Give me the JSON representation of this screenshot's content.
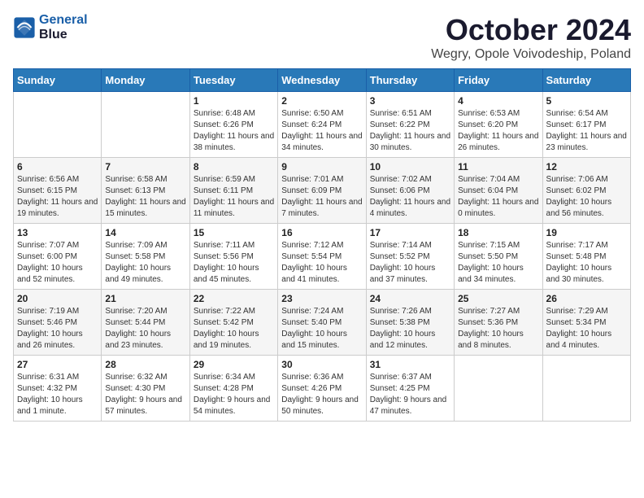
{
  "logo": {
    "line1": "General",
    "line2": "Blue"
  },
  "title": "October 2024",
  "location": "Wegry, Opole Voivodeship, Poland",
  "weekdays": [
    "Sunday",
    "Monday",
    "Tuesday",
    "Wednesday",
    "Thursday",
    "Friday",
    "Saturday"
  ],
  "weeks": [
    [
      {
        "day": "",
        "sunrise": "",
        "sunset": "",
        "daylight": ""
      },
      {
        "day": "",
        "sunrise": "",
        "sunset": "",
        "daylight": ""
      },
      {
        "day": "1",
        "sunrise": "Sunrise: 6:48 AM",
        "sunset": "Sunset: 6:26 PM",
        "daylight": "Daylight: 11 hours and 38 minutes."
      },
      {
        "day": "2",
        "sunrise": "Sunrise: 6:50 AM",
        "sunset": "Sunset: 6:24 PM",
        "daylight": "Daylight: 11 hours and 34 minutes."
      },
      {
        "day": "3",
        "sunrise": "Sunrise: 6:51 AM",
        "sunset": "Sunset: 6:22 PM",
        "daylight": "Daylight: 11 hours and 30 minutes."
      },
      {
        "day": "4",
        "sunrise": "Sunrise: 6:53 AM",
        "sunset": "Sunset: 6:20 PM",
        "daylight": "Daylight: 11 hours and 26 minutes."
      },
      {
        "day": "5",
        "sunrise": "Sunrise: 6:54 AM",
        "sunset": "Sunset: 6:17 PM",
        "daylight": "Daylight: 11 hours and 23 minutes."
      }
    ],
    [
      {
        "day": "6",
        "sunrise": "Sunrise: 6:56 AM",
        "sunset": "Sunset: 6:15 PM",
        "daylight": "Daylight: 11 hours and 19 minutes."
      },
      {
        "day": "7",
        "sunrise": "Sunrise: 6:58 AM",
        "sunset": "Sunset: 6:13 PM",
        "daylight": "Daylight: 11 hours and 15 minutes."
      },
      {
        "day": "8",
        "sunrise": "Sunrise: 6:59 AM",
        "sunset": "Sunset: 6:11 PM",
        "daylight": "Daylight: 11 hours and 11 minutes."
      },
      {
        "day": "9",
        "sunrise": "Sunrise: 7:01 AM",
        "sunset": "Sunset: 6:09 PM",
        "daylight": "Daylight: 11 hours and 7 minutes."
      },
      {
        "day": "10",
        "sunrise": "Sunrise: 7:02 AM",
        "sunset": "Sunset: 6:06 PM",
        "daylight": "Daylight: 11 hours and 4 minutes."
      },
      {
        "day": "11",
        "sunrise": "Sunrise: 7:04 AM",
        "sunset": "Sunset: 6:04 PM",
        "daylight": "Daylight: 11 hours and 0 minutes."
      },
      {
        "day": "12",
        "sunrise": "Sunrise: 7:06 AM",
        "sunset": "Sunset: 6:02 PM",
        "daylight": "Daylight: 10 hours and 56 minutes."
      }
    ],
    [
      {
        "day": "13",
        "sunrise": "Sunrise: 7:07 AM",
        "sunset": "Sunset: 6:00 PM",
        "daylight": "Daylight: 10 hours and 52 minutes."
      },
      {
        "day": "14",
        "sunrise": "Sunrise: 7:09 AM",
        "sunset": "Sunset: 5:58 PM",
        "daylight": "Daylight: 10 hours and 49 minutes."
      },
      {
        "day": "15",
        "sunrise": "Sunrise: 7:11 AM",
        "sunset": "Sunset: 5:56 PM",
        "daylight": "Daylight: 10 hours and 45 minutes."
      },
      {
        "day": "16",
        "sunrise": "Sunrise: 7:12 AM",
        "sunset": "Sunset: 5:54 PM",
        "daylight": "Daylight: 10 hours and 41 minutes."
      },
      {
        "day": "17",
        "sunrise": "Sunrise: 7:14 AM",
        "sunset": "Sunset: 5:52 PM",
        "daylight": "Daylight: 10 hours and 37 minutes."
      },
      {
        "day": "18",
        "sunrise": "Sunrise: 7:15 AM",
        "sunset": "Sunset: 5:50 PM",
        "daylight": "Daylight: 10 hours and 34 minutes."
      },
      {
        "day": "19",
        "sunrise": "Sunrise: 7:17 AM",
        "sunset": "Sunset: 5:48 PM",
        "daylight": "Daylight: 10 hours and 30 minutes."
      }
    ],
    [
      {
        "day": "20",
        "sunrise": "Sunrise: 7:19 AM",
        "sunset": "Sunset: 5:46 PM",
        "daylight": "Daylight: 10 hours and 26 minutes."
      },
      {
        "day": "21",
        "sunrise": "Sunrise: 7:20 AM",
        "sunset": "Sunset: 5:44 PM",
        "daylight": "Daylight: 10 hours and 23 minutes."
      },
      {
        "day": "22",
        "sunrise": "Sunrise: 7:22 AM",
        "sunset": "Sunset: 5:42 PM",
        "daylight": "Daylight: 10 hours and 19 minutes."
      },
      {
        "day": "23",
        "sunrise": "Sunrise: 7:24 AM",
        "sunset": "Sunset: 5:40 PM",
        "daylight": "Daylight: 10 hours and 15 minutes."
      },
      {
        "day": "24",
        "sunrise": "Sunrise: 7:26 AM",
        "sunset": "Sunset: 5:38 PM",
        "daylight": "Daylight: 10 hours and 12 minutes."
      },
      {
        "day": "25",
        "sunrise": "Sunrise: 7:27 AM",
        "sunset": "Sunset: 5:36 PM",
        "daylight": "Daylight: 10 hours and 8 minutes."
      },
      {
        "day": "26",
        "sunrise": "Sunrise: 7:29 AM",
        "sunset": "Sunset: 5:34 PM",
        "daylight": "Daylight: 10 hours and 4 minutes."
      }
    ],
    [
      {
        "day": "27",
        "sunrise": "Sunrise: 6:31 AM",
        "sunset": "Sunset: 4:32 PM",
        "daylight": "Daylight: 10 hours and 1 minute."
      },
      {
        "day": "28",
        "sunrise": "Sunrise: 6:32 AM",
        "sunset": "Sunset: 4:30 PM",
        "daylight": "Daylight: 9 hours and 57 minutes."
      },
      {
        "day": "29",
        "sunrise": "Sunrise: 6:34 AM",
        "sunset": "Sunset: 4:28 PM",
        "daylight": "Daylight: 9 hours and 54 minutes."
      },
      {
        "day": "30",
        "sunrise": "Sunrise: 6:36 AM",
        "sunset": "Sunset: 4:26 PM",
        "daylight": "Daylight: 9 hours and 50 minutes."
      },
      {
        "day": "31",
        "sunrise": "Sunrise: 6:37 AM",
        "sunset": "Sunset: 4:25 PM",
        "daylight": "Daylight: 9 hours and 47 minutes."
      },
      {
        "day": "",
        "sunrise": "",
        "sunset": "",
        "daylight": ""
      },
      {
        "day": "",
        "sunrise": "",
        "sunset": "",
        "daylight": ""
      }
    ]
  ]
}
